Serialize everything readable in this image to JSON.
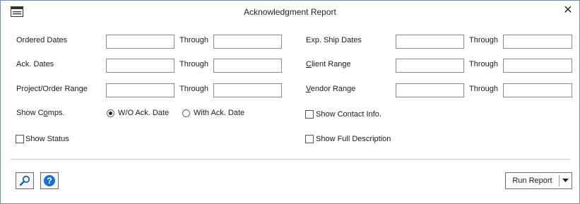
{
  "window": {
    "title": "Acknowledgment Report",
    "close_glyph": "✕"
  },
  "left_fields": [
    {
      "label": "Ordered Dates",
      "through": "Through",
      "from_value": "",
      "to_value": ""
    },
    {
      "label": "Ack. Dates",
      "through": "Through",
      "from_value": "",
      "to_value": ""
    },
    {
      "label": "Project/Order Range",
      "through": "Through",
      "from_value": "",
      "to_value": ""
    }
  ],
  "right_fields": [
    {
      "label": "Exp. Ship Dates",
      "through": "Through",
      "from_value": "",
      "to_value": ""
    },
    {
      "label_first": "C",
      "label_rest": "lient Range",
      "through": "Through",
      "from_value": "",
      "to_value": ""
    },
    {
      "label_first": "V",
      "label_rest": "endor Range",
      "through": "Through",
      "from_value": "",
      "to_value": ""
    }
  ],
  "show_comps": {
    "label_pre": "Show C",
    "label_u": "o",
    "label_post": "mps.",
    "options": [
      {
        "label": "W/O Ack. Date",
        "selected": true
      },
      {
        "label": "With Ack. Date",
        "selected": false
      }
    ]
  },
  "checkboxes": {
    "show_contact_info": {
      "label": "Show Contact Info.",
      "checked": false
    },
    "show_status": {
      "label": "Show Status",
      "checked": false
    },
    "show_full_description": {
      "label": "Show Full Description",
      "checked": false
    }
  },
  "footer": {
    "run_report_label": "Run Report",
    "preview_icon": "magnifier-icon",
    "help_icon": "help-icon"
  },
  "colors": {
    "help_blue": "#1e6fd0",
    "border": "#6e8fb8"
  }
}
